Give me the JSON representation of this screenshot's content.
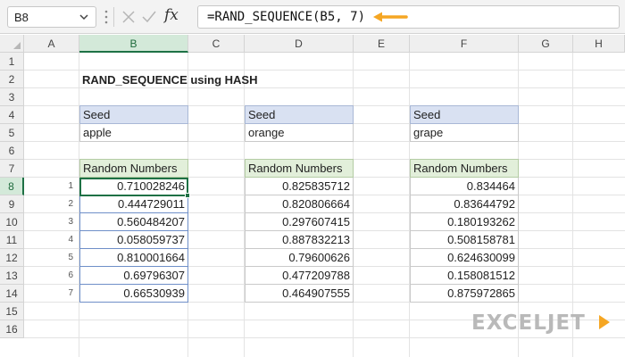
{
  "formula_bar": {
    "name_box": "B8",
    "fx_label": "fx",
    "formula": "=RAND_SEQUENCE(B5, 7)"
  },
  "columns": [
    "A",
    "B",
    "C",
    "D",
    "E",
    "F",
    "G",
    "H"
  ],
  "rows": [
    "1",
    "2",
    "3",
    "4",
    "5",
    "6",
    "7",
    "8",
    "9",
    "10",
    "11",
    "12",
    "13",
    "14",
    "15",
    "16"
  ],
  "sheet": {
    "title": "RAND_SEQUENCE using HASH",
    "seed_header": "Seed",
    "random_header": "Random Numbers",
    "index_labels": [
      "1",
      "2",
      "3",
      "4",
      "5",
      "6",
      "7"
    ],
    "blocks": [
      {
        "seed": "apple",
        "values": [
          "0.710028246",
          "0.444729011",
          "0.560484207",
          "0.058059737",
          "0.810001664",
          "0.69796307",
          "0.66530939"
        ]
      },
      {
        "seed": "orange",
        "values": [
          "0.825835712",
          "0.820806664",
          "0.297607415",
          "0.887832213",
          "0.79600626",
          "0.477209788",
          "0.464907555"
        ]
      },
      {
        "seed": "grape",
        "values": [
          "0.834464",
          "0.83644792",
          "0.180193262",
          "0.508158781",
          "0.624630099",
          "0.158081512",
          "0.875972865"
        ]
      }
    ]
  },
  "logo": {
    "text": "EXCELJET"
  },
  "colors": {
    "accent_green": "#1e7145",
    "seed_header_fill": "#d9e1f2",
    "random_header_fill": "#e2efda",
    "arrow": "#f5a623",
    "logo_gray": "#b9b9b9"
  }
}
